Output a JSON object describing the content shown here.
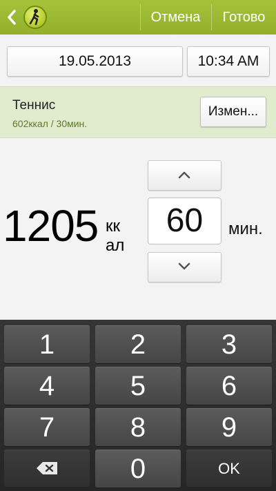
{
  "header": {
    "back_icon": "chevron-left-icon",
    "logo_icon": "walking-person-icon",
    "cancel_label": "Отмена",
    "done_label": "Готово",
    "accent_color": "#9ab833"
  },
  "datetime": {
    "date": "19.05.2013",
    "time": "10:34 AM"
  },
  "activity": {
    "name": "Теннис",
    "summary": "602ккал / 30мин.",
    "change_label": "Измен..."
  },
  "calories": {
    "value": "1205",
    "unit": "кк ал"
  },
  "duration": {
    "value": "60",
    "unit": "мин.",
    "up_icon": "chevron-up-icon",
    "down_icon": "chevron-down-icon"
  },
  "keypad": {
    "keys": [
      "1",
      "2",
      "3",
      "4",
      "5",
      "6",
      "7",
      "8",
      "9",
      "",
      "0",
      "OK"
    ],
    "backspace_icon": "backspace-icon"
  }
}
